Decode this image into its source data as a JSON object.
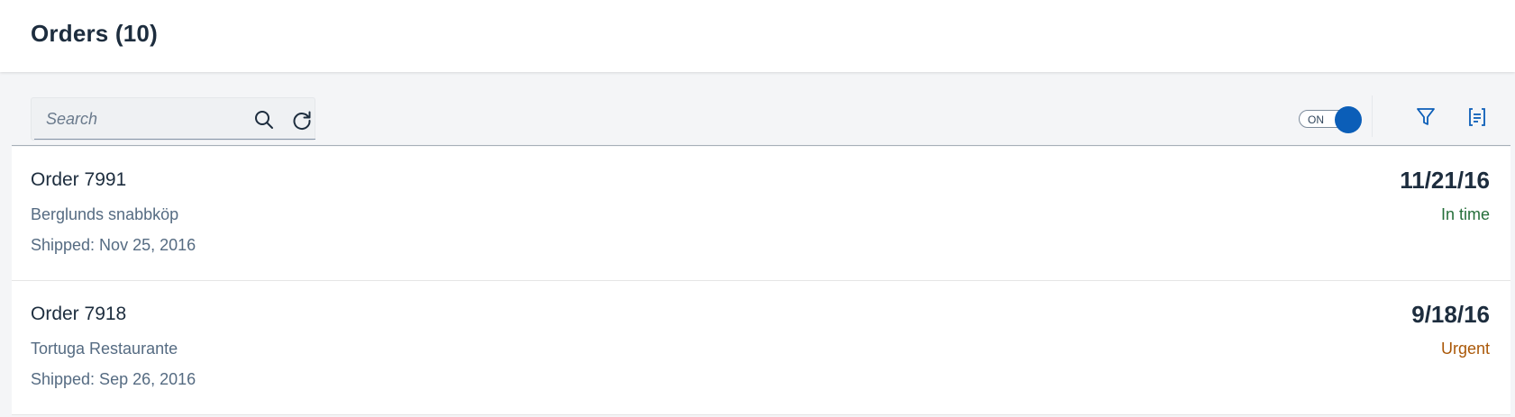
{
  "header": {
    "title": "Orders (10)"
  },
  "toolbar": {
    "search": {
      "placeholder": "Search",
      "value": ""
    },
    "switch": {
      "label": "ON",
      "state": "on"
    },
    "icons": {
      "search": "search-icon",
      "refresh": "refresh-icon",
      "filter": "filter-icon",
      "settings": "view-settings-icon"
    }
  },
  "colors": {
    "accent": "#0b5eb8",
    "in_time": "#256f3a",
    "urgent": "#aa5808",
    "text_primary": "#1d2d3e",
    "text_secondary": "#556b82"
  },
  "orders": [
    {
      "title": "Order 7991",
      "customer": "Berglunds snabbköp",
      "shipped": "Shipped: Nov 25, 2016",
      "date": "11/21/16",
      "status": "In time"
    },
    {
      "title": "Order 7918",
      "customer": "Tortuga Restaurante",
      "shipped": "Shipped: Sep 26, 2016",
      "date": "9/18/16",
      "status": "Urgent"
    }
  ]
}
